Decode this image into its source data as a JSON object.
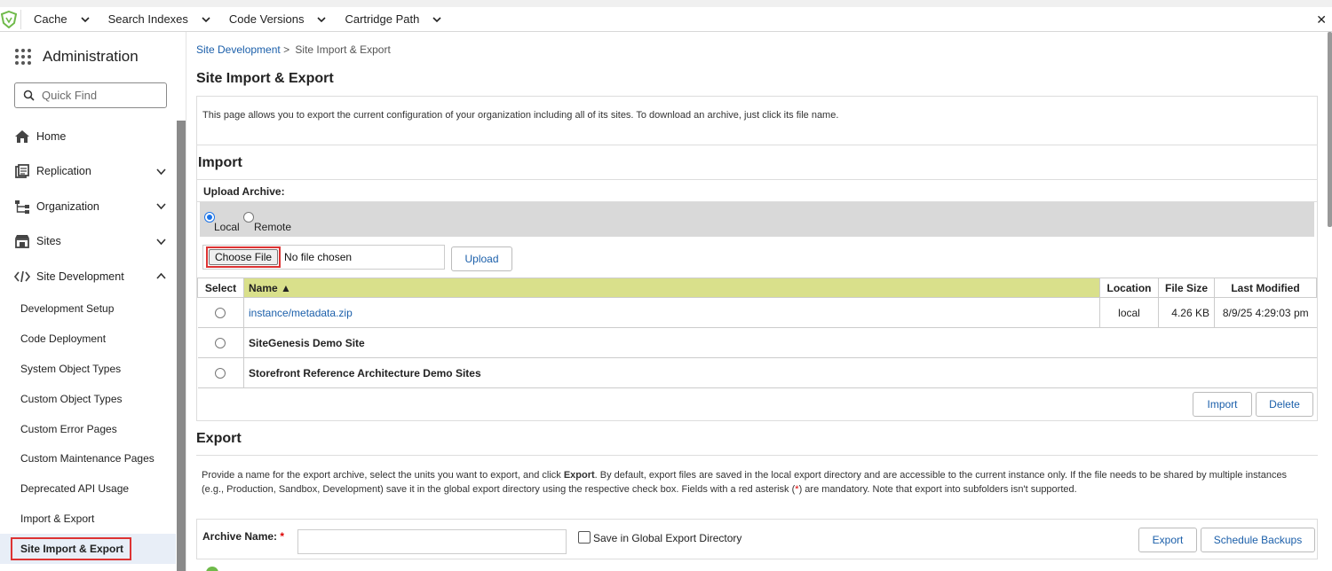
{
  "topbar": {
    "menus": [
      {
        "label": "Cache"
      },
      {
        "label": "Search Indexes"
      },
      {
        "label": "Code Versions"
      },
      {
        "label": "Cartridge Path"
      }
    ],
    "close_label": "✕"
  },
  "sidebar": {
    "title": "Administration",
    "quickfind_placeholder": "Quick Find",
    "items": [
      {
        "label": "Home",
        "icon": "home-icon"
      },
      {
        "label": "Replication",
        "icon": "replication-icon"
      },
      {
        "label": "Organization",
        "icon": "organization-icon"
      },
      {
        "label": "Sites",
        "icon": "sites-icon"
      },
      {
        "label": "Site Development",
        "icon": "code-icon"
      }
    ],
    "subitems": [
      {
        "label": "Development Setup"
      },
      {
        "label": "Code Deployment"
      },
      {
        "label": "System Object Types"
      },
      {
        "label": "Custom Object Types"
      },
      {
        "label": "Custom Error Pages"
      },
      {
        "label": "Custom Maintenance Pages"
      },
      {
        "label": "Deprecated API Usage"
      },
      {
        "label": "Import & Export"
      },
      {
        "label": "Site Import & Export"
      }
    ]
  },
  "breadcrumb": {
    "parent": "Site Development",
    "separator": ">",
    "current": "Site Import & Export"
  },
  "page_title": "Site Import & Export",
  "info_text": "This page allows you to export the current configuration of your organization including all of its sites. To download an archive, just click its file name.",
  "import": {
    "title": "Import",
    "upload_label": "Upload Archive:",
    "local_label": "Local",
    "remote_label": "Remote",
    "choose_file_label": "Choose File",
    "no_file_label": "No file chosen",
    "upload_button": "Upload",
    "columns": {
      "select": "Select",
      "name": "Name ▲",
      "location": "Location",
      "size": "File Size",
      "modified": "Last Modified"
    },
    "rows": [
      {
        "name": "instance/metadata.zip",
        "location": "local",
        "size": "4.26 KB",
        "modified": "8/9/25 4:29:03 pm"
      },
      {
        "name": "SiteGenesis Demo Site",
        "location": "",
        "size": "",
        "modified": ""
      },
      {
        "name": "Storefront Reference Architecture Demo Sites",
        "location": "",
        "size": "",
        "modified": ""
      }
    ],
    "import_button": "Import",
    "delete_button": "Delete"
  },
  "export": {
    "title": "Export",
    "desc_1": "Provide a name for the export archive, select the units you want to export, and click ",
    "desc_bold": "Export",
    "desc_2": ". By default, export files are saved in the local export directory and are accessible to the current instance only. If the file needs to be shared by multiple instances (e.g., Production, Sandbox, Development) save it in the global export directory using the respective check box. Fields with a red asterisk (",
    "desc_star": "*",
    "desc_3": ") are mandatory. Note that export into subfolders isn't supported.",
    "archive_label": "Archive Name:",
    "required_star": "*",
    "archive_value": "",
    "global_checkbox_label": "Save in Global Export Directory",
    "export_button": "Export",
    "schedule_button": "Schedule Backups"
  }
}
